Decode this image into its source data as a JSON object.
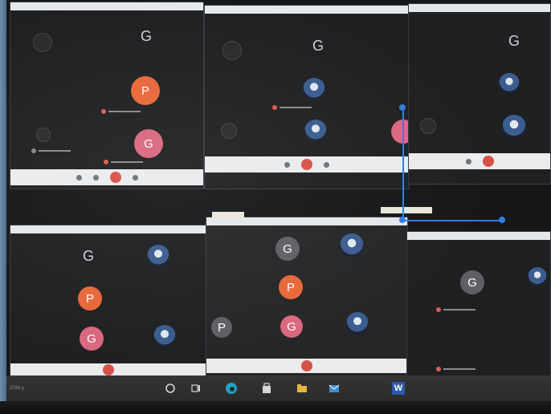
{
  "scene": "photo of laptop screen showing a grid of video-call windows",
  "tiles": [
    {
      "name": "top-left",
      "letter_avatars": [
        "P",
        "G"
      ],
      "header_letter": "G"
    },
    {
      "name": "top-middle",
      "header_letter": "G"
    },
    {
      "name": "top-right",
      "header_letter": "G"
    },
    {
      "name": "bottom-left",
      "header_letter": "G",
      "letter_avatars": [
        "P",
        "G"
      ]
    },
    {
      "name": "bottom-middle",
      "letter_avatars": [
        "G",
        "P",
        "P",
        "G"
      ]
    },
    {
      "name": "bottom-right",
      "letter_avatars": [
        "G"
      ]
    }
  ],
  "avatar_letters": {
    "tl_header": "G",
    "tl_orange": "P",
    "tl_pink": "G",
    "tm_header": "G",
    "tr_header": "G",
    "bl_header": "G",
    "bl_orange": "P",
    "bl_pink": "G",
    "bm_top": "G",
    "bm_orange": "P",
    "bm_gray": "P",
    "bm_pink": "G",
    "br_gray": "G"
  },
  "taskbar": {
    "left_text": "203à ỵ",
    "word_icon_letter": "W"
  },
  "colors": {
    "avatar_orange": "#e7683a",
    "avatar_pink": "#d9687e",
    "hangup_red": "#d85146",
    "selection_blue": "#2d7fe0"
  }
}
